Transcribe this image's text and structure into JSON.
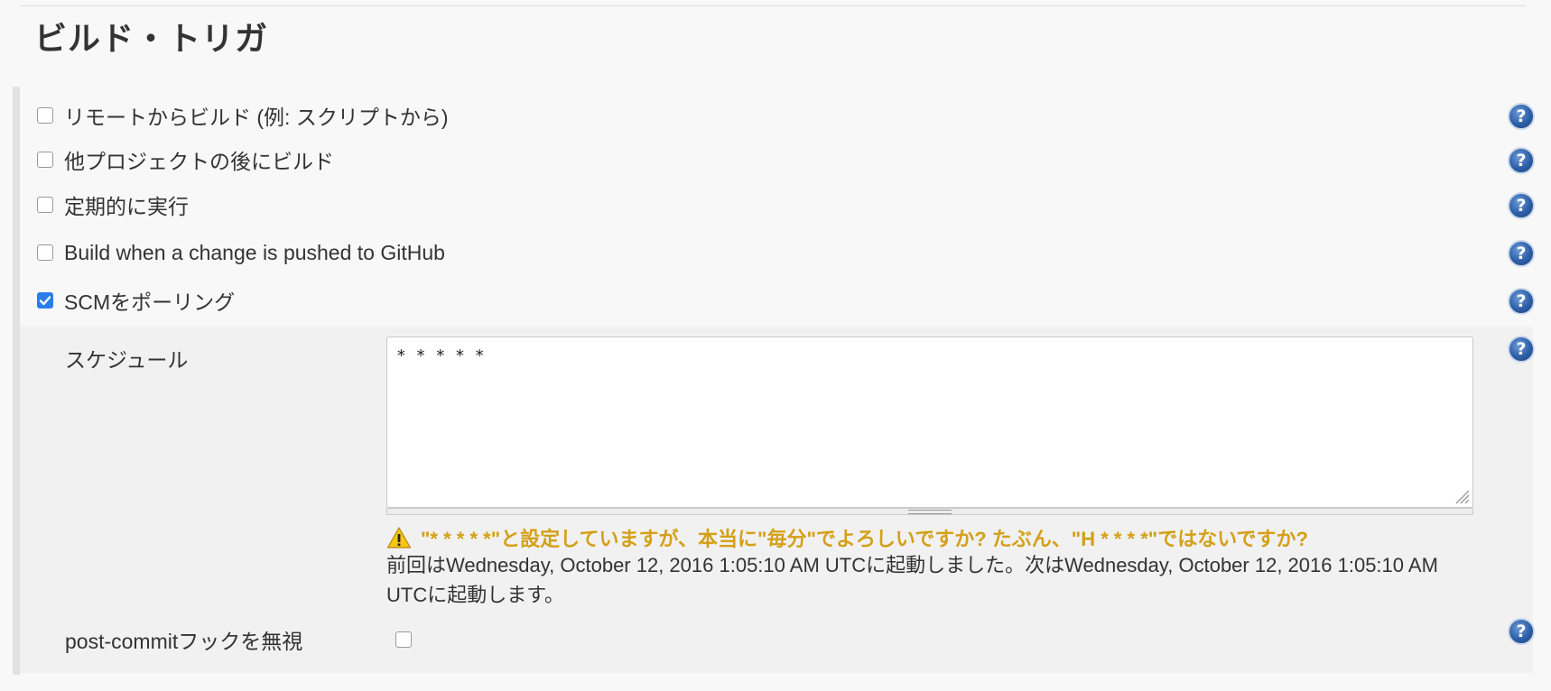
{
  "section": {
    "title": "ビルド・トリガ"
  },
  "triggers": [
    {
      "label": "リモートからビルド (例: スクリプトから)",
      "checked": false
    },
    {
      "label": "他プロジェクトの後にビルド",
      "checked": false
    },
    {
      "label": "定期的に実行",
      "checked": false
    },
    {
      "label": "Build when a change is pushed to GitHub",
      "checked": false
    },
    {
      "label": "SCMをポーリング",
      "checked": true
    }
  ],
  "help": {
    "glyph": "?"
  },
  "scm": {
    "schedule_label": "スケジュール",
    "schedule_value": "* * * * *",
    "warning": "\"* * * * *\"と設定していますが、本当に\"毎分\"でよろしいですか? たぶん、\"H * * * *\"ではないですか?",
    "info": "前回はWednesday, October 12, 2016 1:05:10 AM UTCに起動しました。次はWednesday, October 12, 2016 1:05:10 AM UTCに起動します。",
    "ignore_post_commit_label": "post-commitフックを無視",
    "ignore_post_commit_checked": false
  },
  "colors": {
    "checkbox_checked": "#2b7de9",
    "warning_text": "#d4a017",
    "help_icon": "#2d5fa8"
  }
}
